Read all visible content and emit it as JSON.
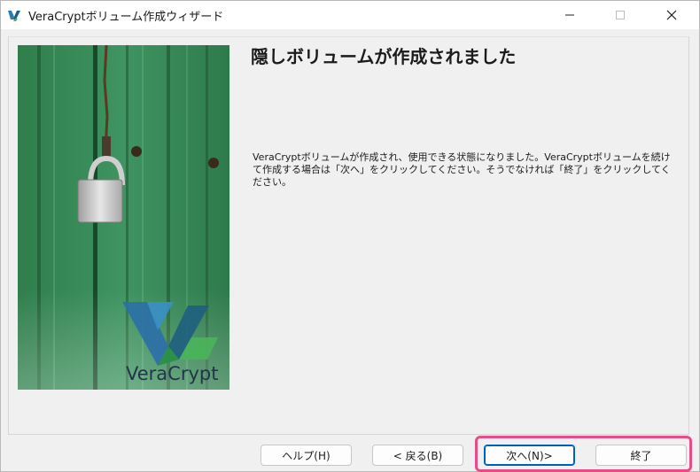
{
  "window": {
    "title": "VeraCryptボリューム作成ウィザード"
  },
  "main": {
    "heading": "隠しボリュームが作成されました",
    "info": "VeraCryptボリュームが作成され、使用できる状態になりました。VeraCryptボリュームを続けて作成する場合は「次へ」をクリックしてください。そうでなければ「終了」をクリックしてください。"
  },
  "hero": {
    "brand_text": "VeraCrypt"
  },
  "buttons": {
    "help": "ヘルプ(H)",
    "back": "< 戻る(B)",
    "next": "次へ(N)>",
    "finish": "終了"
  },
  "colors": {
    "accent": "#005fb8",
    "highlight": "#ea4b86",
    "door_green": "#3f8b59"
  }
}
